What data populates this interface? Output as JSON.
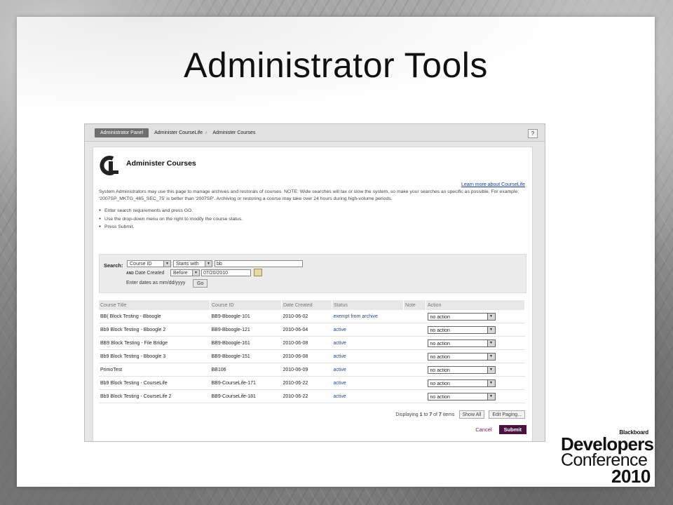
{
  "slide": {
    "title": "Administrator Tools"
  },
  "breadcrumb": {
    "panel": "Administrator Panel",
    "item1": "Administer CourseLife",
    "item2": "Administer Courses",
    "help": "?"
  },
  "page": {
    "heading": "Administer Courses",
    "learn_more": "Learn more about CourseLife",
    "description": "System Administrators may use this page to manage archives and restorals of courses. NOTE: Wide searches will tax or slow the system, so make your searches as specific as possible. For example: '2007SP_MKTG_465_SEC_75' is better than '2007SP'. Archiving or restoring a course may take over 24 hours during high-volume periods.",
    "bullets": [
      "Enter search requirements and press GO.",
      "Use the drop-down menu on the right to modify the course status.",
      "Press Submit."
    ]
  },
  "search": {
    "label": "Search:",
    "field_select": "Course ID",
    "op_select": "Starts with",
    "value": "bb",
    "and_label": "AND",
    "date_label": "Date Created",
    "date_op": "Before",
    "date_value": "07/20/2010",
    "date_hint": "Enter dates as mm/dd/yyyy",
    "go": "Go"
  },
  "table": {
    "headers": [
      "Course Title",
      "Course ID",
      "Date Created",
      "Status",
      "Note",
      "Action"
    ],
    "rows": [
      {
        "title": "BB( Block Testing - Bboogle",
        "id": "BB9-Bboogle-101",
        "date": "2010-06-02",
        "status": "exempt from archive",
        "note": "",
        "action": "no action"
      },
      {
        "title": "Bb9 Block Testing - Bboogle 2",
        "id": "BB9-Bboogle-121",
        "date": "2010-06-04",
        "status": "active",
        "note": "",
        "action": "no action"
      },
      {
        "title": "BB9 Block Testing - File Bridge",
        "id": "BB9-Bboogle-161",
        "date": "2010-06-08",
        "status": "active",
        "note": "",
        "action": "no action"
      },
      {
        "title": "Bb9 Block Testing - Bboogle 3",
        "id": "BB9-Bboogle-151",
        "date": "2010-06-08",
        "status": "active",
        "note": "",
        "action": "no action"
      },
      {
        "title": "PrimoTest",
        "id": "BB106",
        "date": "2010-06-09",
        "status": "active",
        "note": "",
        "action": "no action"
      },
      {
        "title": "Bb9 Block Testing - CourseLife",
        "id": "BB9-CourseLife-171",
        "date": "2010-06-22",
        "status": "active",
        "note": "",
        "action": "no action"
      },
      {
        "title": "Bb9 Block Testing - CourseLife 2",
        "id": "BB9-CourseLife-181",
        "date": "2010-06-22",
        "status": "active",
        "note": "",
        "action": "no action"
      }
    ]
  },
  "paging": {
    "prefix": "Displaying ",
    "from": "1",
    "to_word": " to ",
    "to": "7",
    "of_word": " of ",
    "total": "7",
    "suffix": " items",
    "show_all": "Show All",
    "edit_paging": "Edit Paging..."
  },
  "actions": {
    "cancel": "Cancel",
    "submit": "Submit"
  },
  "brand": {
    "top": "Blackboard",
    "line1": "Developers",
    "line2": "Conference",
    "line3": "2010"
  },
  "colors": {
    "submit": "#4a1040",
    "status_link": "#1a4a9a",
    "link": "#1a3c8c"
  }
}
